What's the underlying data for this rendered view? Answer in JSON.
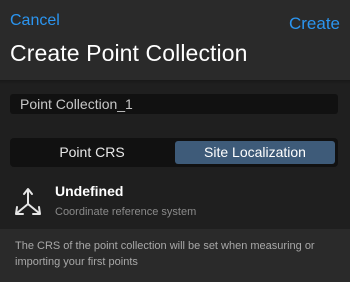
{
  "header": {
    "cancel_label": "Cancel",
    "create_label": "Create",
    "title": "Create Point Collection"
  },
  "name_field": {
    "value": "Point Collection_1"
  },
  "segmented_control": {
    "options": [
      {
        "label": "Point CRS",
        "selected": false
      },
      {
        "label": "Site Localization",
        "selected": true
      }
    ]
  },
  "crs": {
    "icon": "axes-icon",
    "title": "Undefined",
    "subtitle": "Coordinate reference system"
  },
  "info": {
    "text": "The CRS of the point collection will be set when measuring or importing your first points"
  },
  "colors": {
    "accent": "#2b95f0",
    "selected_segment": "#3e5b79",
    "background": "#1f1f1f"
  }
}
